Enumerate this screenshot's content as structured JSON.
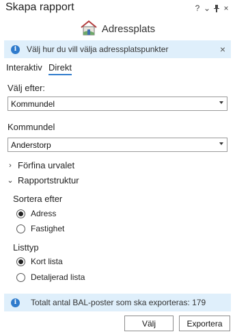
{
  "window": {
    "title": "Skapa rapport",
    "controls": {
      "help": "?",
      "menu": "⌄",
      "pin": "⊥",
      "close": "×"
    }
  },
  "tool": {
    "name": "Adressplats",
    "icon": "house-icon"
  },
  "info_top": {
    "text": "Välj hur du vill välja adressplatspunkter",
    "close": "×"
  },
  "tabs": [
    {
      "label": "Interaktiv",
      "active": false
    },
    {
      "label": "Direkt",
      "active": true
    }
  ],
  "select_by": {
    "label": "Välj efter:",
    "value": "Kommundel"
  },
  "kommundel": {
    "label": "Kommundel",
    "value": "Anderstorp"
  },
  "refine": {
    "label": "Förfina urvalet",
    "expanded": false
  },
  "structure": {
    "label": "Rapportstruktur",
    "expanded": true
  },
  "sort": {
    "label": "Sortera efter",
    "options": [
      {
        "label": "Adress",
        "selected": true
      },
      {
        "label": "Fastighet",
        "selected": false
      }
    ]
  },
  "listtype": {
    "label": "Listtyp",
    "options": [
      {
        "label": "Kort lista",
        "selected": true
      },
      {
        "label": "Detaljerad lista",
        "selected": false
      }
    ]
  },
  "info_bottom": {
    "text": "Totalt antal BAL-poster som ska exporteras: 179"
  },
  "buttons": {
    "select": "Välj",
    "export": "Exportera"
  },
  "colors": {
    "accent": "#2f7bcc",
    "infobar": "#dfeffb"
  }
}
